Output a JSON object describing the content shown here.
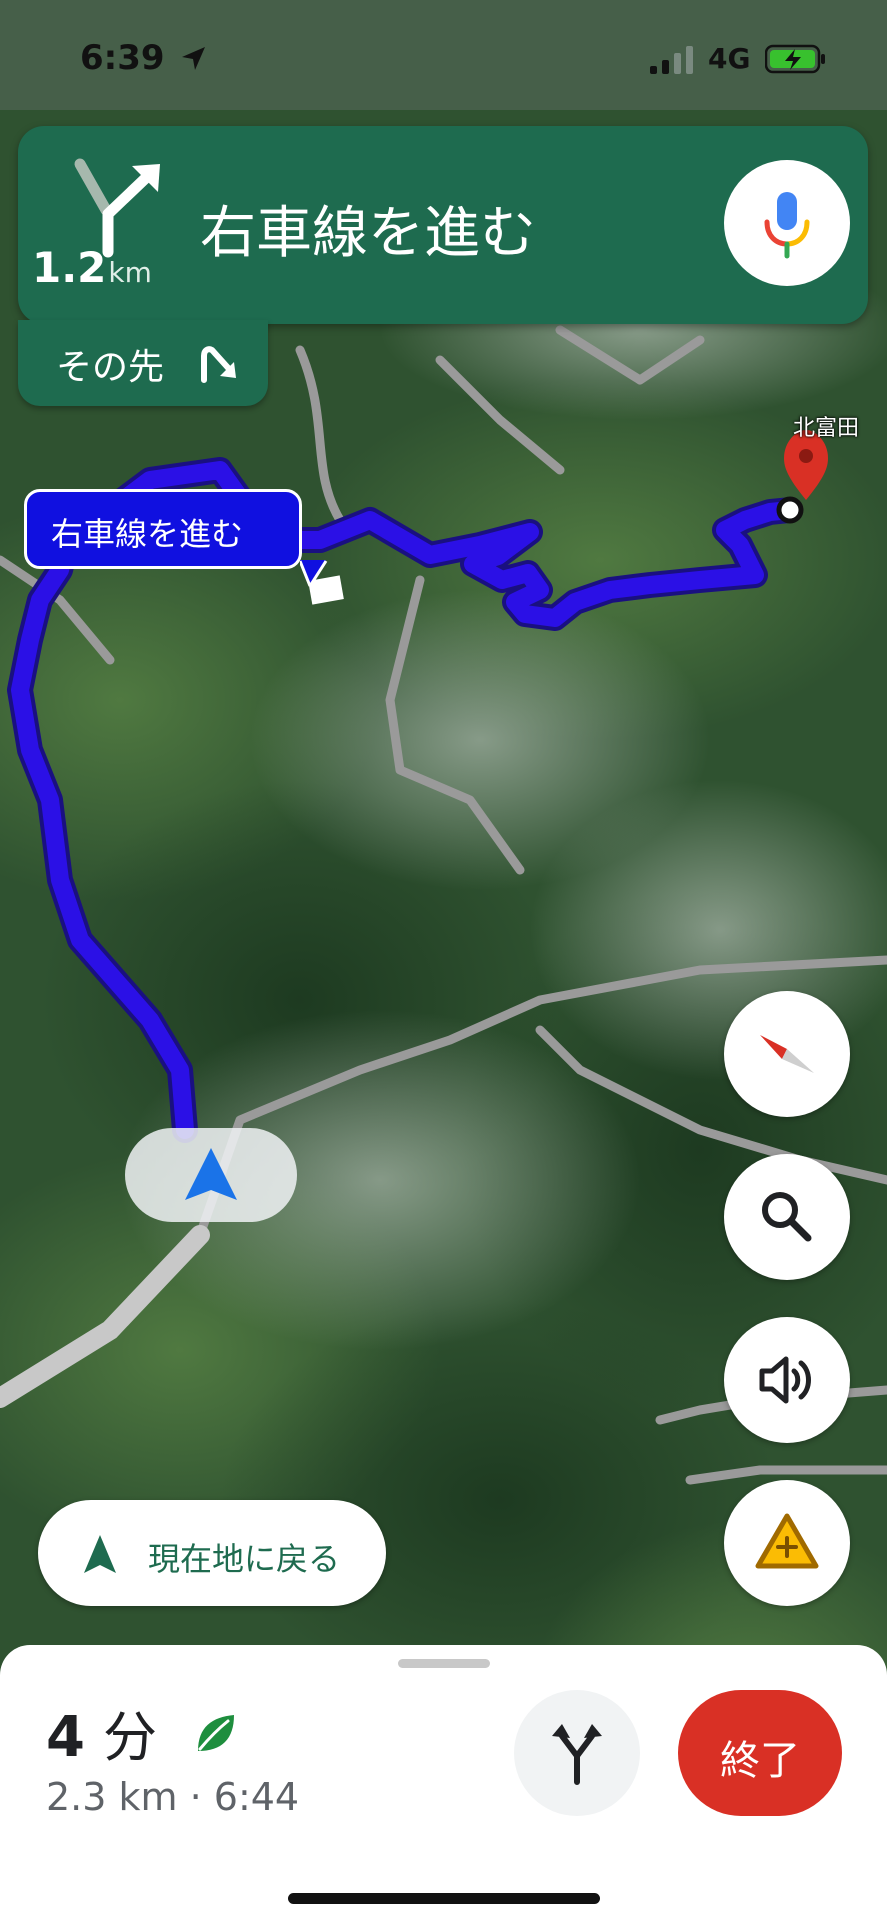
{
  "status_bar": {
    "time": "6:39",
    "network": "4G"
  },
  "navigation": {
    "distance_value": "1.2",
    "distance_unit": "km",
    "instruction": "右車線を進む",
    "then_label": "その先"
  },
  "map": {
    "destination_label": "北富田",
    "callout_text": "右車線を進む",
    "colors": {
      "route": "#2b10e6",
      "road": "#9a9a9a",
      "destination_pin": "#d93025"
    }
  },
  "controls": {
    "compass_icon": "compass-icon",
    "search_icon": "search-icon",
    "sound_icon": "speaker-icon",
    "report_icon": "report-incident-icon"
  },
  "recenter": {
    "label": "現在地に戻る"
  },
  "trip": {
    "minutes": "4",
    "minutes_unit": "分",
    "details": "2.3 km · 6:44",
    "exit_label": "終了",
    "colors": {
      "exit": "#d93025",
      "eco_leaf": "#1e8e3e"
    }
  }
}
